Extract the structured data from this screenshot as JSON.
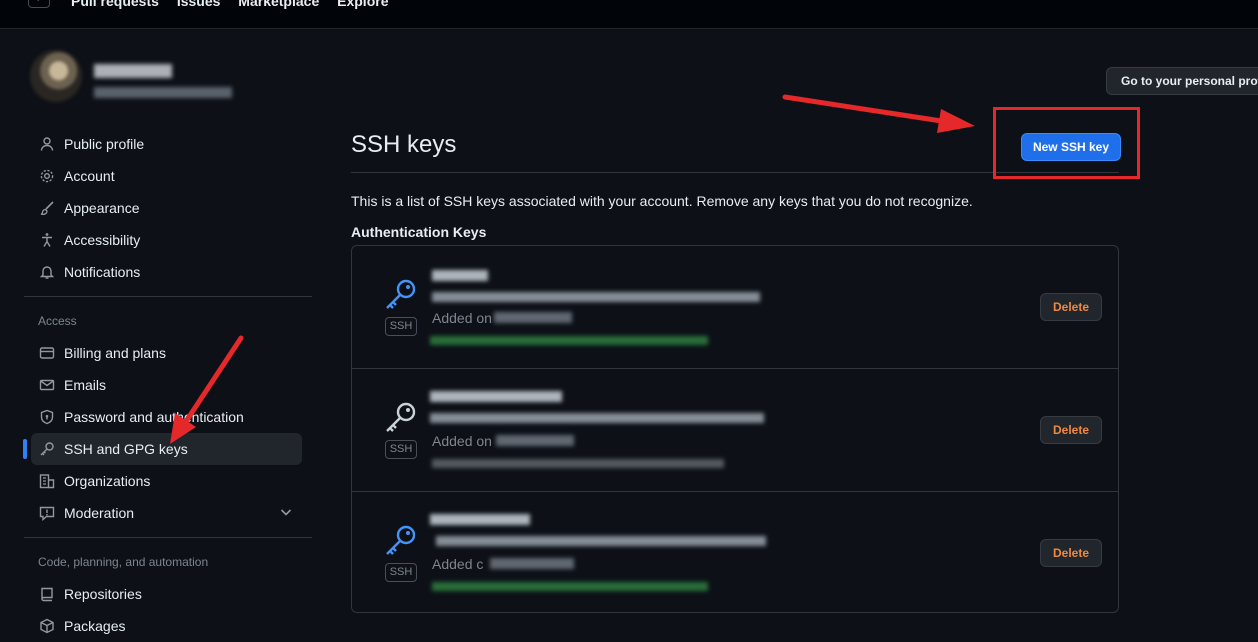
{
  "topbar": {
    "slash_key": "/",
    "nav": [
      "Pull requests",
      "Issues",
      "Marketplace",
      "Explore"
    ]
  },
  "header": {
    "profile_button": "Go to your personal profile"
  },
  "sidebar": {
    "items_top": [
      {
        "label": "Public profile",
        "icon": "person-icon"
      },
      {
        "label": "Account",
        "icon": "gear-icon"
      },
      {
        "label": "Appearance",
        "icon": "paintbrush-icon"
      },
      {
        "label": "Accessibility",
        "icon": "accessibility-icon"
      },
      {
        "label": "Notifications",
        "icon": "bell-icon"
      }
    ],
    "access_heading": "Access",
    "items_access": [
      {
        "label": "Billing and plans",
        "icon": "credit-card-icon"
      },
      {
        "label": "Emails",
        "icon": "mail-icon"
      },
      {
        "label": "Password and authentication",
        "icon": "shield-lock-icon"
      },
      {
        "label": "SSH and GPG keys",
        "icon": "key-icon"
      },
      {
        "label": "Organizations",
        "icon": "organization-icon"
      },
      {
        "label": "Moderation",
        "icon": "report-icon"
      }
    ],
    "code_heading": "Code, planning, and automation",
    "items_code": [
      {
        "label": "Repositories",
        "icon": "repo-icon"
      },
      {
        "label": "Packages",
        "icon": "package-icon"
      }
    ]
  },
  "main": {
    "title": "SSH keys",
    "new_button": "New SSH key",
    "description": "This is a list of SSH keys associated with your account. Remove any keys that you do not recognize.",
    "auth_heading": "Authentication Keys",
    "keys": [
      {
        "badge": "SSH",
        "added_label": "Added on",
        "delete_label": "Delete"
      },
      {
        "badge": "SSH",
        "added_label": "Added on",
        "delete_label": "Delete"
      },
      {
        "badge": "SSH",
        "added_label": "Added c",
        "delete_label": "Delete"
      }
    ]
  },
  "colors": {
    "background": "#0d1117",
    "accent": "#1f6feb",
    "danger_text": "#f0883e",
    "annotation": "#e5282a",
    "active_indicator": "#2f81f7",
    "key_icon": "#4493f8"
  }
}
